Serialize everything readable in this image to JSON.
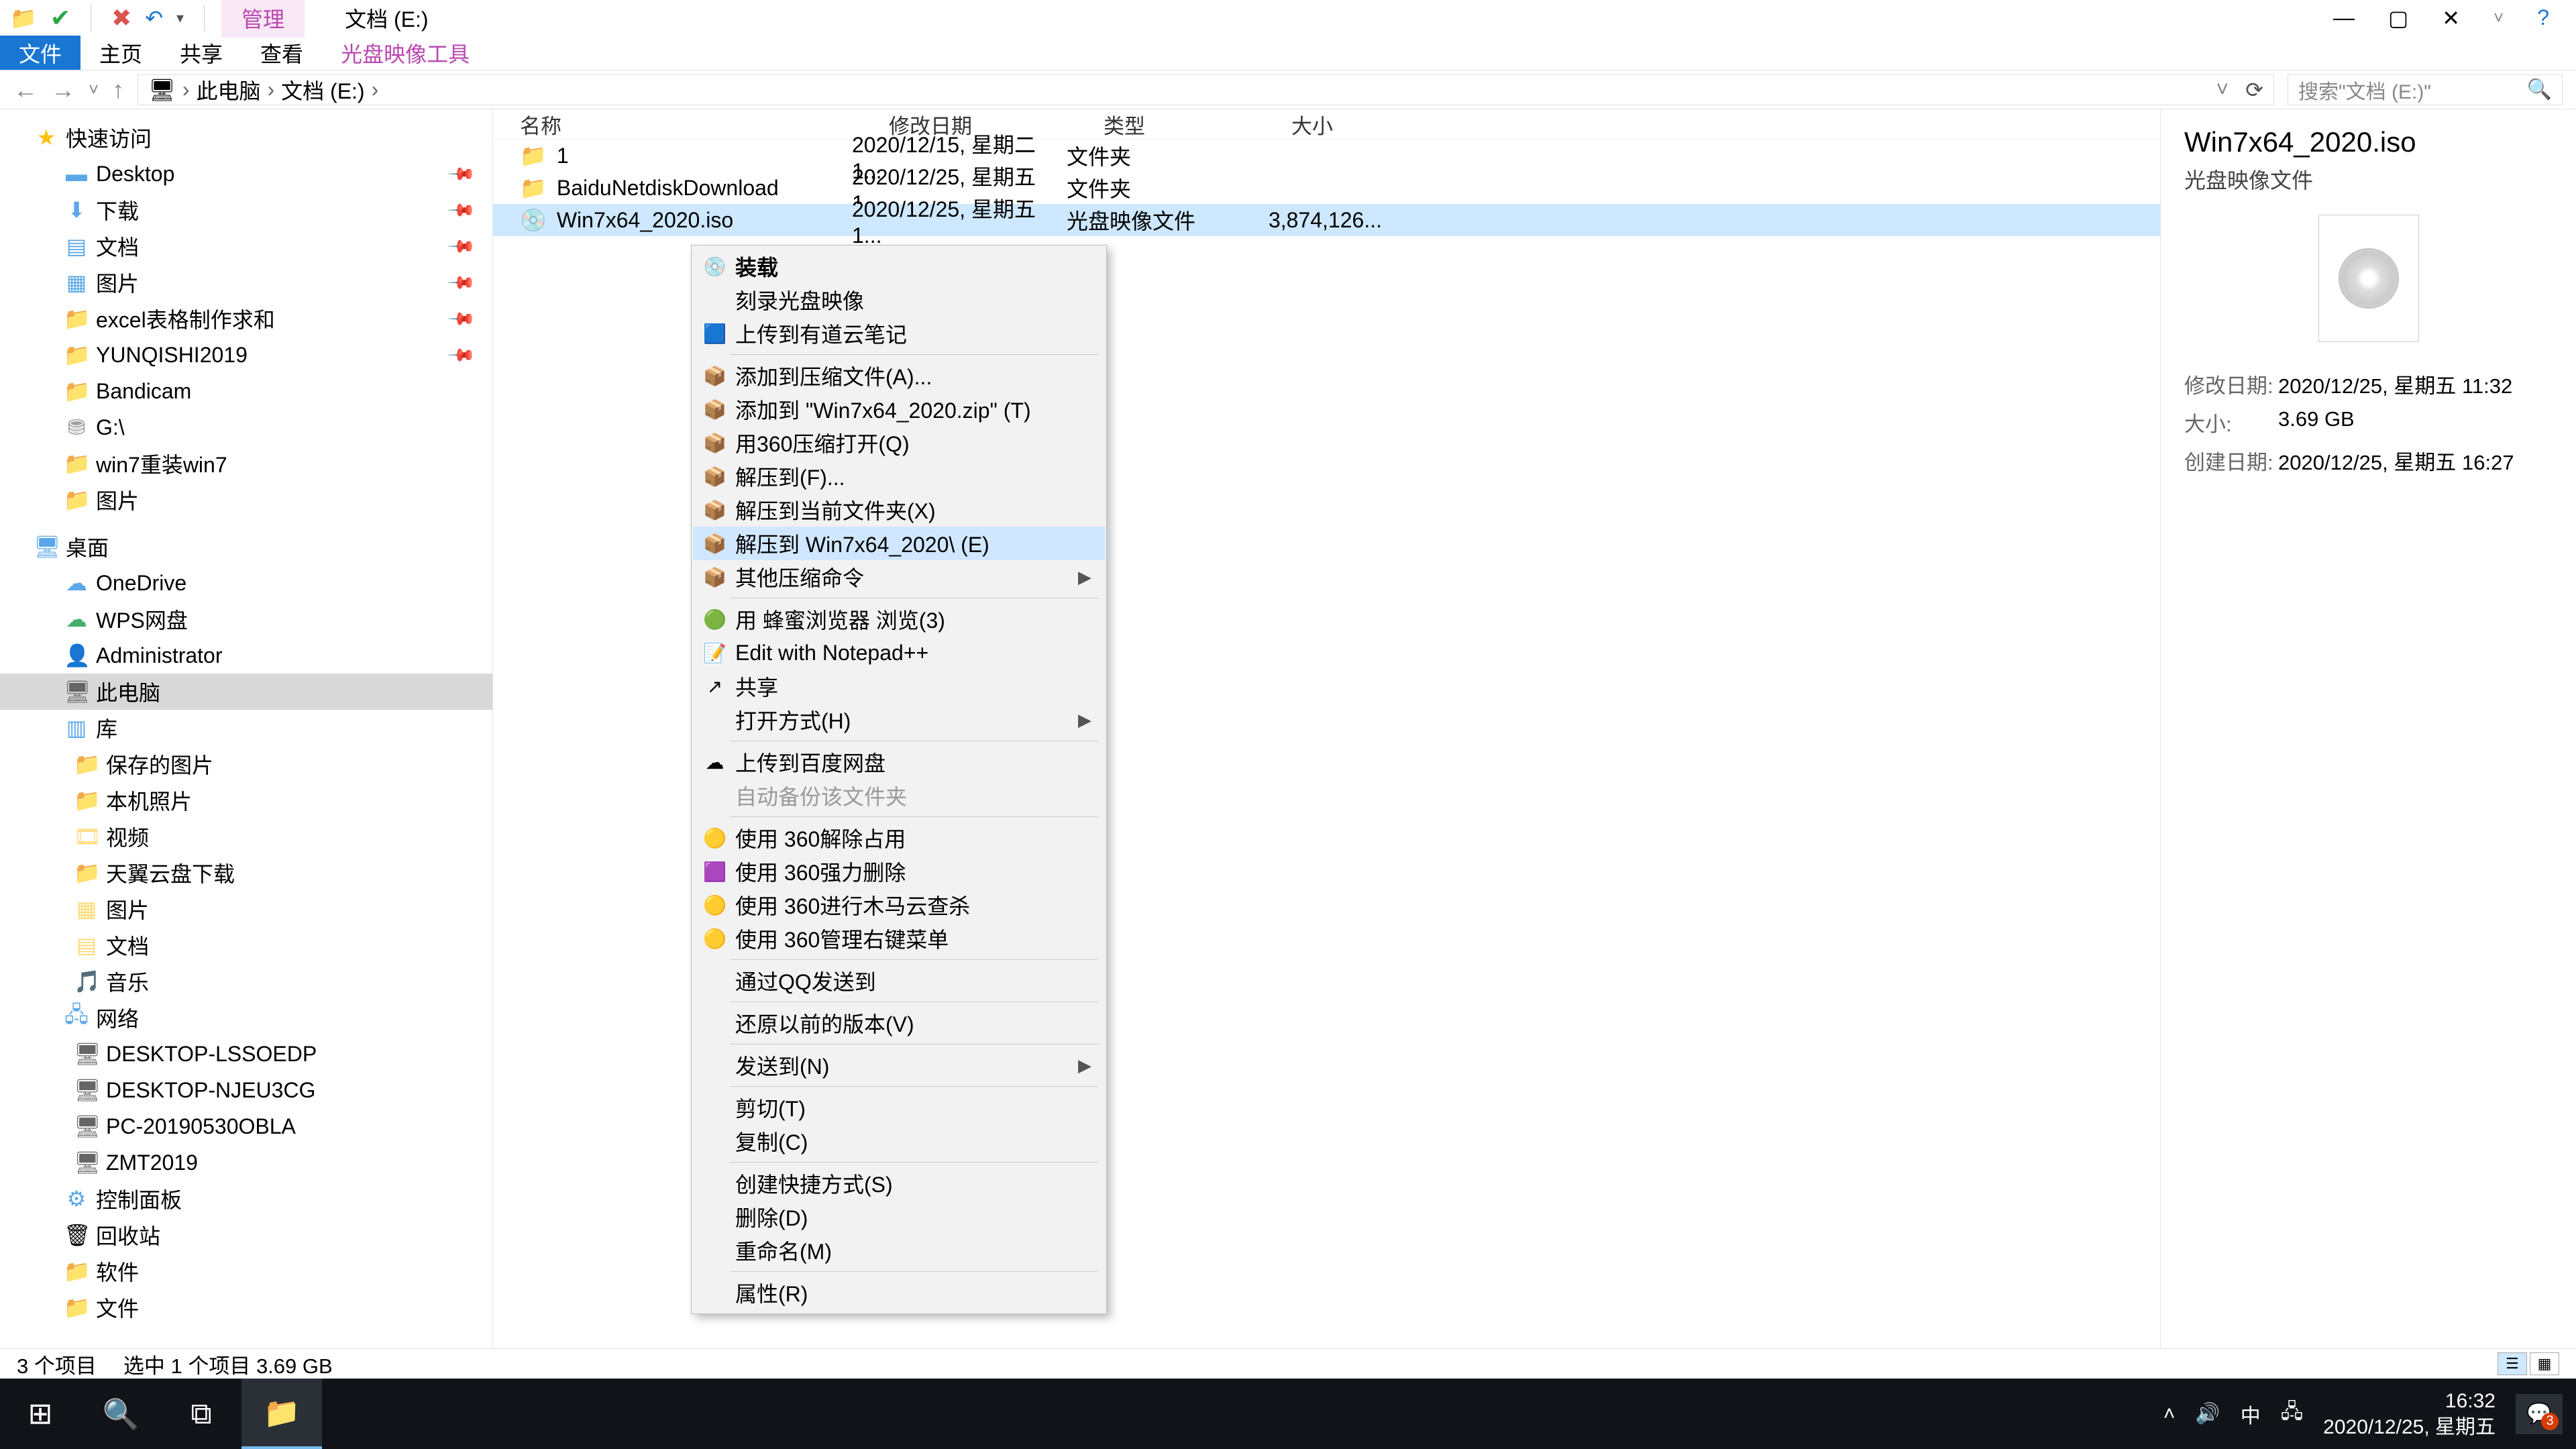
{
  "title": "文档 (E:)",
  "qat": {
    "dropdown_label": "▾"
  },
  "tabs": {
    "manage": "管理",
    "file": "文件",
    "home": "主页",
    "share": "共享",
    "view": "查看",
    "disc_tool": "光盘映像工具"
  },
  "window": {
    "min": "—",
    "max": "▢",
    "close": "✕",
    "help": "?"
  },
  "breadcrumb": {
    "pc": "此电脑",
    "drive": "文档 (E:)",
    "sep": "›"
  },
  "nav_btns": {
    "back": "←",
    "fwd": "→",
    "up": "↑",
    "dd": "˅",
    "refresh": "⟳"
  },
  "search": {
    "placeholder": "搜索\"文档 (E:)\"",
    "icon": "🔍"
  },
  "columns": {
    "name": "名称",
    "date": "修改日期",
    "type": "类型",
    "size": "大小"
  },
  "tree": {
    "quick": "快速访问",
    "desktop": "Desktop",
    "downloads": "下载",
    "documents": "文档",
    "pictures": "图片",
    "excel": "excel表格制作求和",
    "yunqishi": "YUNQISHI2019",
    "bandicam": "Bandicam",
    "gdrive": "G:\\",
    "win7re": "win7重装win7",
    "pictures2": "图片",
    "desktop_cn": "桌面",
    "onedrive": "OneDrive",
    "wps": "WPS网盘",
    "admin": "Administrator",
    "thispc": "此电脑",
    "libraries": "库",
    "saved_pics": "保存的图片",
    "local_pics": "本机照片",
    "videos": "视频",
    "tianyi": "天翼云盘下载",
    "pics_lib": "图片",
    "docs_lib": "文档",
    "music": "音乐",
    "network": "网络",
    "pc1": "DESKTOP-LSSOEDP",
    "pc2": "DESKTOP-NJEU3CG",
    "pc3": "PC-20190530OBLA",
    "pc4": "ZMT2019",
    "ctrl_panel": "控制面板",
    "recycle": "回收站",
    "software": "软件",
    "files": "文件"
  },
  "files": [
    {
      "name": "1",
      "date": "2020/12/15, 星期二 1...",
      "type": "文件夹",
      "size": ""
    },
    {
      "name": "BaiduNetdiskDownload",
      "date": "2020/12/25, 星期五 1...",
      "type": "文件夹",
      "size": ""
    },
    {
      "name": "Win7x64_2020.iso",
      "date": "2020/12/25, 星期五 1...",
      "type": "光盘映像文件",
      "size": "3,874,126..."
    }
  ],
  "ctx": [
    {
      "icon": "💿",
      "label": "装载",
      "bold": true
    },
    {
      "icon": "",
      "label": "刻录光盘映像"
    },
    {
      "icon": "🟦",
      "label": "上传到有道云笔记"
    },
    {
      "sep": true
    },
    {
      "icon": "📦",
      "label": "添加到压缩文件(A)..."
    },
    {
      "icon": "📦",
      "label": "添加到 \"Win7x64_2020.zip\" (T)"
    },
    {
      "icon": "📦",
      "label": "用360压缩打开(Q)"
    },
    {
      "icon": "📦",
      "label": "解压到(F)..."
    },
    {
      "icon": "📦",
      "label": "解压到当前文件夹(X)"
    },
    {
      "icon": "📦",
      "label": "解压到 Win7x64_2020\\ (E)",
      "hover": true
    },
    {
      "icon": "📦",
      "label": "其他压缩命令",
      "arrow": true
    },
    {
      "sep": true
    },
    {
      "icon": "🟢",
      "label": "用 蜂蜜浏览器 浏览(3)"
    },
    {
      "icon": "📝",
      "label": "Edit with Notepad++"
    },
    {
      "icon": "↗",
      "label": "共享"
    },
    {
      "icon": "",
      "label": "打开方式(H)",
      "arrow": true
    },
    {
      "sep": true
    },
    {
      "icon": "☁",
      "label": "上传到百度网盘"
    },
    {
      "icon": "",
      "label": "自动备份该文件夹",
      "disabled": true
    },
    {
      "sep": true
    },
    {
      "icon": "🟡",
      "label": "使用 360解除占用"
    },
    {
      "icon": "🟪",
      "label": "使用 360强力删除"
    },
    {
      "icon": "🟡",
      "label": "使用 360进行木马云查杀"
    },
    {
      "icon": "🟡",
      "label": "使用 360管理右键菜单"
    },
    {
      "sep": true
    },
    {
      "icon": "",
      "label": "通过QQ发送到"
    },
    {
      "sep": true
    },
    {
      "icon": "",
      "label": "还原以前的版本(V)"
    },
    {
      "sep": true
    },
    {
      "icon": "",
      "label": "发送到(N)",
      "arrow": true
    },
    {
      "sep": true
    },
    {
      "icon": "",
      "label": "剪切(T)"
    },
    {
      "icon": "",
      "label": "复制(C)"
    },
    {
      "sep": true
    },
    {
      "icon": "",
      "label": "创建快捷方式(S)"
    },
    {
      "icon": "",
      "label": "删除(D)"
    },
    {
      "icon": "",
      "label": "重命名(M)"
    },
    {
      "sep": true
    },
    {
      "icon": "",
      "label": "属性(R)"
    }
  ],
  "preview": {
    "title": "Win7x64_2020.iso",
    "type": "光盘映像文件",
    "rows": [
      {
        "k": "修改日期:",
        "v": "2020/12/25, 星期五 11:32"
      },
      {
        "k": "大小:",
        "v": "3.69 GB"
      },
      {
        "k": "创建日期:",
        "v": "2020/12/25, 星期五 16:27"
      }
    ]
  },
  "status": {
    "count": "3 个项目",
    "selection": "选中 1 个项目  3.69 GB"
  },
  "taskbar": {
    "start": "⊞",
    "search": "🔍",
    "taskview": "⧉",
    "explorer": "📁",
    "tray": {
      "up": "˄",
      "sound": "🔊",
      "ime": "中",
      "net": "🖧"
    },
    "clock": {
      "time": "16:32",
      "date": "2020/12/25, 星期五"
    },
    "badge": "3"
  }
}
